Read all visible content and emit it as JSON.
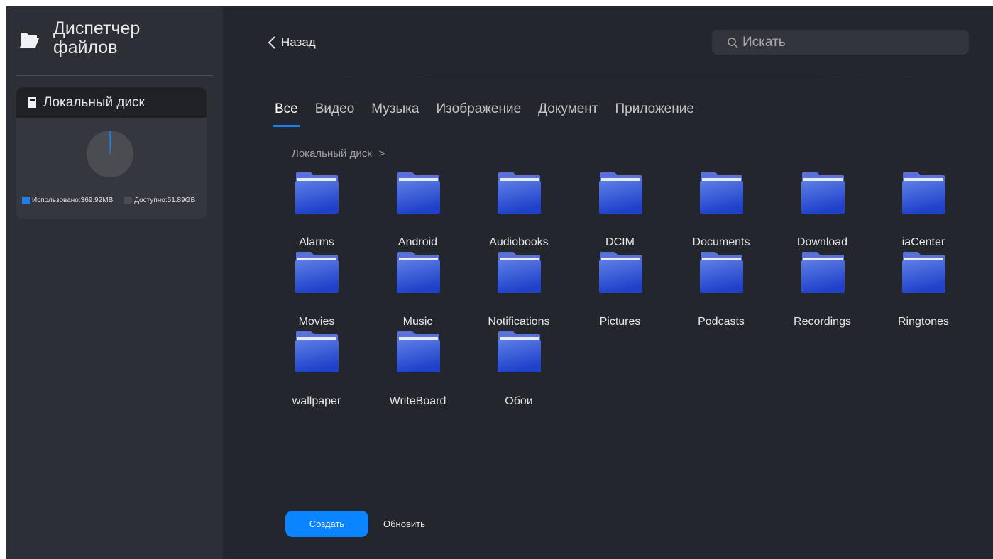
{
  "app": {
    "title": "Диспетчер файлов",
    "icon": "folder-open-icon"
  },
  "sidebar": {
    "disk": {
      "title": "Локальный диск",
      "icon": "sd-card-icon",
      "used_label": "Использовано:369.92MB",
      "free_label": "Доступно:51.89GB",
      "used_fraction": 0.007,
      "used_color": "#1e7fe8",
      "free_color": "#4a4c52"
    }
  },
  "header": {
    "back_label": "Назад",
    "search_placeholder": "Искать"
  },
  "tabs": [
    {
      "label": "Все",
      "active": true
    },
    {
      "label": "Видео",
      "active": false
    },
    {
      "label": "Музыка",
      "active": false
    },
    {
      "label": "Изображение",
      "active": false
    },
    {
      "label": "Документ",
      "active": false
    },
    {
      "label": "Приложение",
      "active": false
    }
  ],
  "breadcrumb": {
    "path": "Локальный диск",
    "separator": ">"
  },
  "folders": [
    "Alarms",
    "Android",
    "Audiobooks",
    "DCIM",
    "Documents",
    "Download",
    "iaCenter",
    "Movies",
    "Music",
    "Notifications",
    "Pictures",
    "Podcasts",
    "Recordings",
    "Ringtones",
    "wallpaper",
    "WriteBoard",
    "Обои"
  ],
  "footer": {
    "create_label": "Создать",
    "refresh_label": "Обновить"
  },
  "colors": {
    "accent": "#0a84ff",
    "folder_top": "#5d7fe6",
    "folder_bottom": "#1f40c9"
  }
}
